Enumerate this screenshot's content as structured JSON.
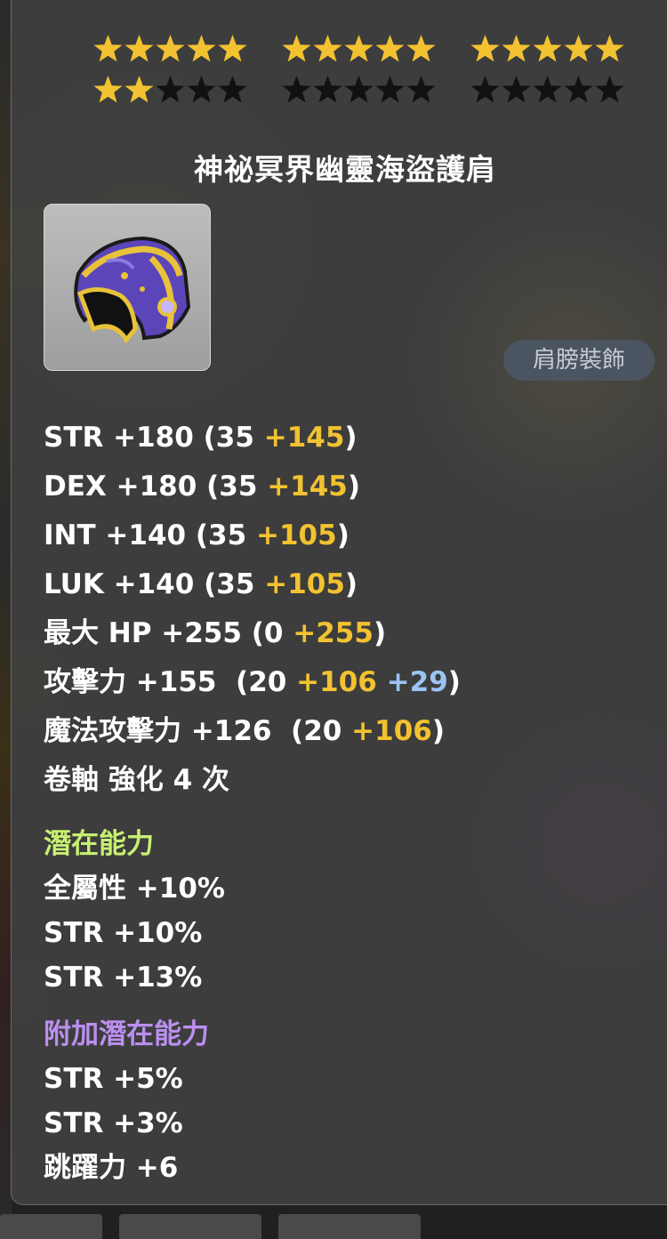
{
  "colors": {
    "star_filled": "#f2c230",
    "star_empty": "#111111",
    "bonus_gold": "#f2c230",
    "bonus_blue": "#9bc4f2",
    "potential_green": "#c7f072",
    "additional_potential_purple": "#bb8ff0",
    "badge_bg": "#4b5461"
  },
  "starforce": {
    "filled": 17,
    "total": 30
  },
  "item": {
    "name": "神祕冥界幽靈海盜護肩",
    "category": "肩膀裝飾",
    "icon": "purple-gold-shoulder-armor-icon"
  },
  "stats": [
    {
      "label": "STR +180 (35 ",
      "bonus_gold": "+145",
      "bonus_blue": "",
      "close": ")"
    },
    {
      "label": "DEX +180 (35 ",
      "bonus_gold": "+145",
      "bonus_blue": "",
      "close": ")"
    },
    {
      "label": "INT +140 (35 ",
      "bonus_gold": "+105",
      "bonus_blue": "",
      "close": ")"
    },
    {
      "label": "LUK +140 (35 ",
      "bonus_gold": "+105",
      "bonus_blue": "",
      "close": ")"
    },
    {
      "label": "最大 HP +255 (0 ",
      "bonus_gold": "+255",
      "bonus_blue": "",
      "close": ")"
    },
    {
      "label": "攻擊力 +155  (20 ",
      "bonus_gold": "+106",
      "bonus_blue": " +29",
      "close": ")"
    },
    {
      "label": "魔法攻擊力 +126  (20 ",
      "bonus_gold": "+106",
      "bonus_blue": "",
      "close": ")"
    }
  ],
  "enhancement": "卷軸 強化 4 次",
  "potential": {
    "title": "潛在能力",
    "lines": [
      "全屬性 +10%",
      "STR +10%",
      "STR +13%"
    ]
  },
  "additional_potential": {
    "title": "附加潛在能力",
    "lines": [
      "STR +5%",
      "STR +3%",
      "跳躍力 +6"
    ]
  }
}
